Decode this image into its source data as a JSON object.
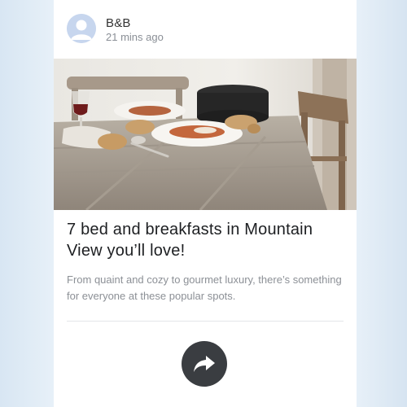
{
  "post": {
    "author": "B&B",
    "timestamp": "21 mins ago",
    "title": "7 bed and breakfasts in Mountain View you’ll love!",
    "description": "From quaint and cozy to gourmet luxury, there’s something for everyone at these popular spots."
  },
  "icons": {
    "avatar": "person-silhouette-icon",
    "share": "share-arrow-icon"
  },
  "colors": {
    "share_button": "#3a3d41",
    "title_text": "#1d1f22",
    "body_text": "#8c9096"
  }
}
